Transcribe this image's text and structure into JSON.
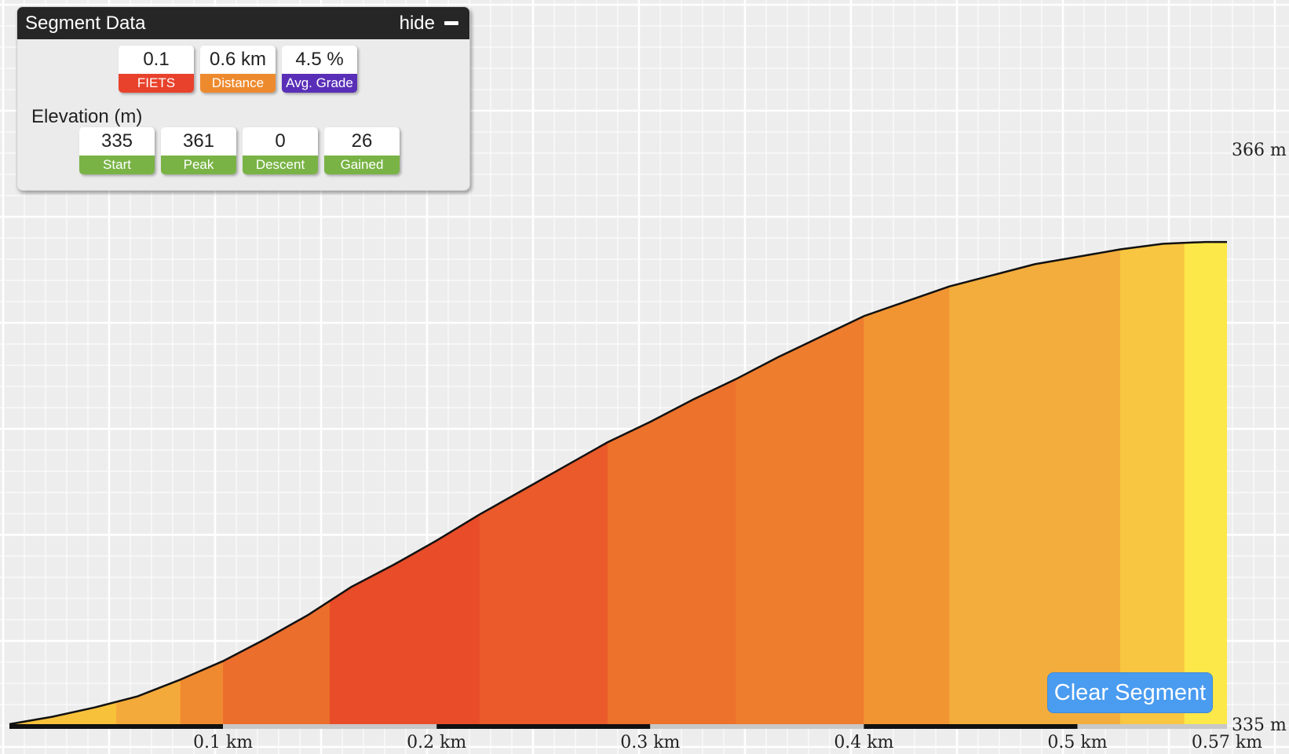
{
  "panel": {
    "title": "Segment Data",
    "hide_label": "hide",
    "stats": [
      {
        "value": "0.1",
        "label": "FIETS",
        "color": "#e8422c"
      },
      {
        "value": "0.6 km",
        "label": "Distance",
        "color": "#ee8a2e"
      },
      {
        "value": "4.5 %",
        "label": "Avg. Grade",
        "color": "#5a2fb8"
      }
    ],
    "elevation_title": "Elevation (m)",
    "elevation_stats": [
      {
        "value": "335",
        "label": "Start",
        "color": "#79b345"
      },
      {
        "value": "361",
        "label": "Peak",
        "color": "#79b345"
      },
      {
        "value": "0",
        "label": "Descent",
        "color": "#79b345"
      },
      {
        "value": "26",
        "label": "Gained",
        "color": "#79b345"
      }
    ]
  },
  "clear_button": "Clear Segment",
  "chart_data": {
    "type": "area",
    "title": "",
    "xlabel": "",
    "ylabel": "",
    "x_unit": "km",
    "y_unit": "m",
    "xlim": [
      0,
      0.57
    ],
    "ylim": [
      335,
      366
    ],
    "x_ticks": [
      {
        "value": 0.1,
        "label": "0.1 km"
      },
      {
        "value": 0.2,
        "label": "0.2 km"
      },
      {
        "value": 0.3,
        "label": "0.3 km"
      },
      {
        "value": 0.4,
        "label": "0.4 km"
      },
      {
        "value": 0.5,
        "label": "0.5 km"
      },
      {
        "value": 0.57,
        "label": "0.57 km"
      }
    ],
    "y_ticks": [
      {
        "value": 366,
        "label": "366 m"
      },
      {
        "value": 335,
        "label": "335 m"
      }
    ],
    "grid": true,
    "x": [
      0,
      0.02,
      0.04,
      0.06,
      0.08,
      0.1,
      0.12,
      0.14,
      0.16,
      0.18,
      0.2,
      0.22,
      0.24,
      0.26,
      0.28,
      0.3,
      0.32,
      0.34,
      0.36,
      0.38,
      0.4,
      0.42,
      0.44,
      0.46,
      0.48,
      0.5,
      0.52,
      0.54,
      0.56,
      0.57
    ],
    "elevation": [
      335.0,
      335.4,
      335.9,
      336.5,
      337.4,
      338.4,
      339.6,
      340.9,
      342.4,
      343.6,
      344.9,
      346.3,
      347.6,
      348.9,
      350.2,
      351.3,
      352.5,
      353.6,
      354.8,
      355.9,
      357.0,
      357.8,
      358.6,
      359.2,
      359.8,
      360.2,
      360.6,
      360.9,
      361.0,
      361.0
    ],
    "grade_bands": [
      {
        "from": 0,
        "to": 0.05,
        "grade": 3.0,
        "color": "#f7c13a"
      },
      {
        "from": 0.05,
        "to": 0.08,
        "grade": 4.0,
        "color": "#f4aa3a"
      },
      {
        "from": 0.08,
        "to": 0.1,
        "grade": 5.0,
        "color": "#ef8a30"
      },
      {
        "from": 0.1,
        "to": 0.15,
        "grade": 6.5,
        "color": "#ec6e2c"
      },
      {
        "from": 0.15,
        "to": 0.22,
        "grade": 7.0,
        "color": "#e84c28"
      },
      {
        "from": 0.22,
        "to": 0.28,
        "grade": 6.5,
        "color": "#ea5a2a"
      },
      {
        "from": 0.28,
        "to": 0.34,
        "grade": 6.0,
        "color": "#ed722c"
      },
      {
        "from": 0.34,
        "to": 0.4,
        "grade": 5.5,
        "color": "#ee7d2e"
      },
      {
        "from": 0.4,
        "to": 0.44,
        "grade": 4.5,
        "color": "#f19532"
      },
      {
        "from": 0.44,
        "to": 0.52,
        "grade": 3.5,
        "color": "#f3ad3c"
      },
      {
        "from": 0.52,
        "to": 0.55,
        "grade": 2.0,
        "color": "#f8c640"
      },
      {
        "from": 0.55,
        "to": 0.57,
        "grade": 0.5,
        "color": "#fce848"
      }
    ]
  }
}
